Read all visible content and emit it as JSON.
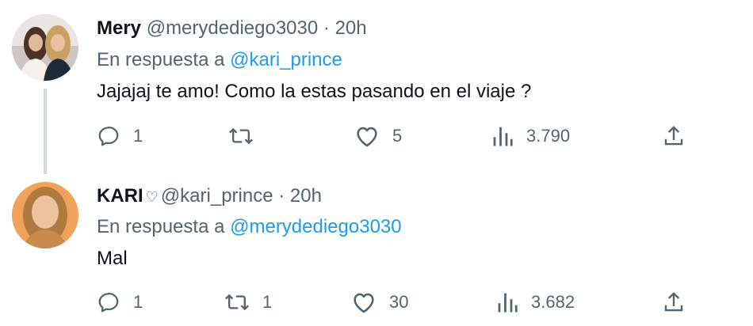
{
  "tweets": [
    {
      "name": "Mery",
      "handle": "@merydediego3030",
      "separator": "·",
      "time": "20h",
      "reply_prefix": "En respuesta a",
      "reply_mention": "@kari_prince",
      "text": "Jajajaj te amo! Como la estas pasando en el viaje ?",
      "replies": "1",
      "retweets": "",
      "likes": "5",
      "views": "3.790"
    },
    {
      "name": "KARI",
      "name_symbol": "♡",
      "handle": "@kari_prince",
      "separator": "·",
      "time": "20h",
      "reply_prefix": "En respuesta a",
      "reply_mention": "@merydediego3030",
      "text": "Mal",
      "replies": "1",
      "retweets": "1",
      "likes": "30",
      "views": "3.682"
    }
  ],
  "icons": {
    "reply": "reply-icon",
    "retweet": "retweet-icon",
    "like": "heart-icon",
    "views": "views-icon",
    "share": "share-icon"
  },
  "colors": {
    "text": "#0f1419",
    "secondary": "#536471",
    "link": "#1d9bf0",
    "thread_line": "#cfd9de"
  }
}
